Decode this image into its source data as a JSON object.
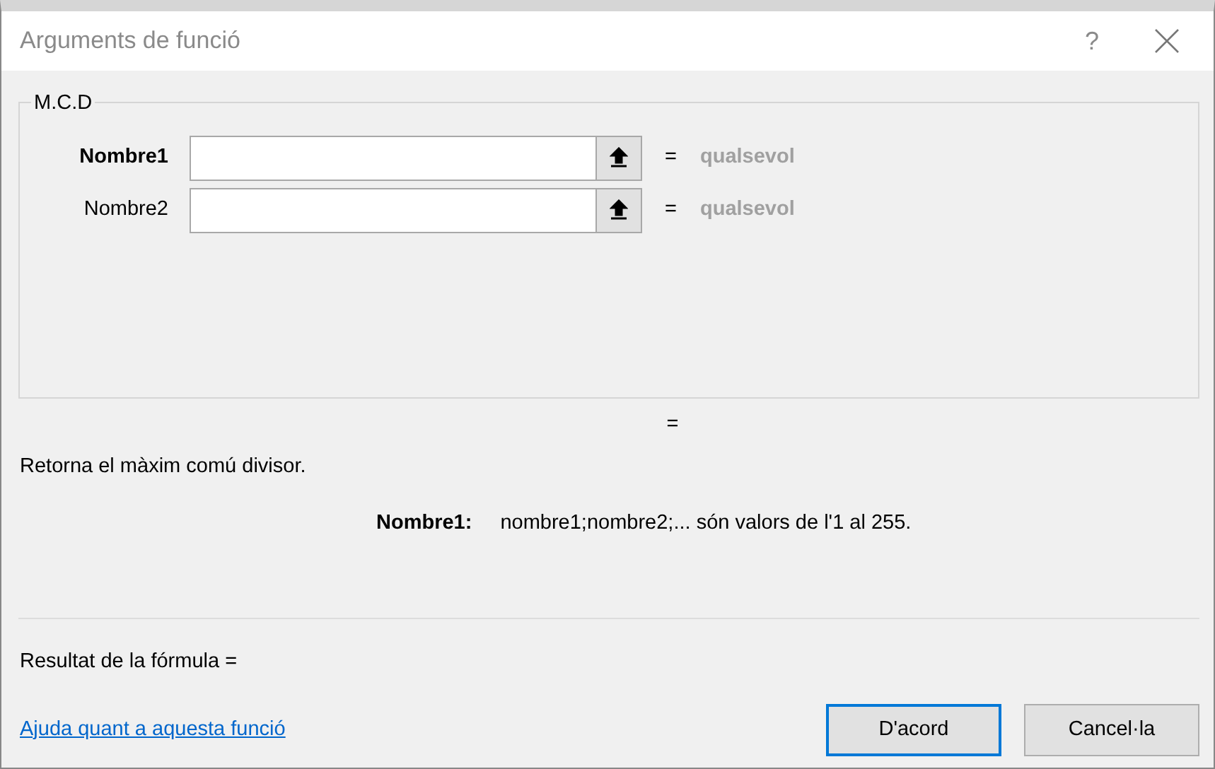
{
  "window": {
    "title": "Arguments de funció",
    "help": "?"
  },
  "group": {
    "title": "M.C.D",
    "arguments": [
      {
        "label": "Nombre1",
        "selected": true,
        "equals": "=",
        "value": "qualsevol"
      },
      {
        "label": "Nombre2",
        "selected": false,
        "equals": "=",
        "value": "qualsevol"
      }
    ]
  },
  "result_equals": "=",
  "description": "Retorna el màxim comú divisor.",
  "argument_help": {
    "label": "Nombre1:",
    "text": "nombre1;nombre2;... són valors de l'1 al 255."
  },
  "formula_result": "Resultat de la fórmula =",
  "help_link": "Ajuda quant a aquesta funció",
  "buttons": [
    {
      "label": "D'acord",
      "default": true
    },
    {
      "label": "Cancel·la",
      "default": false
    }
  ]
}
